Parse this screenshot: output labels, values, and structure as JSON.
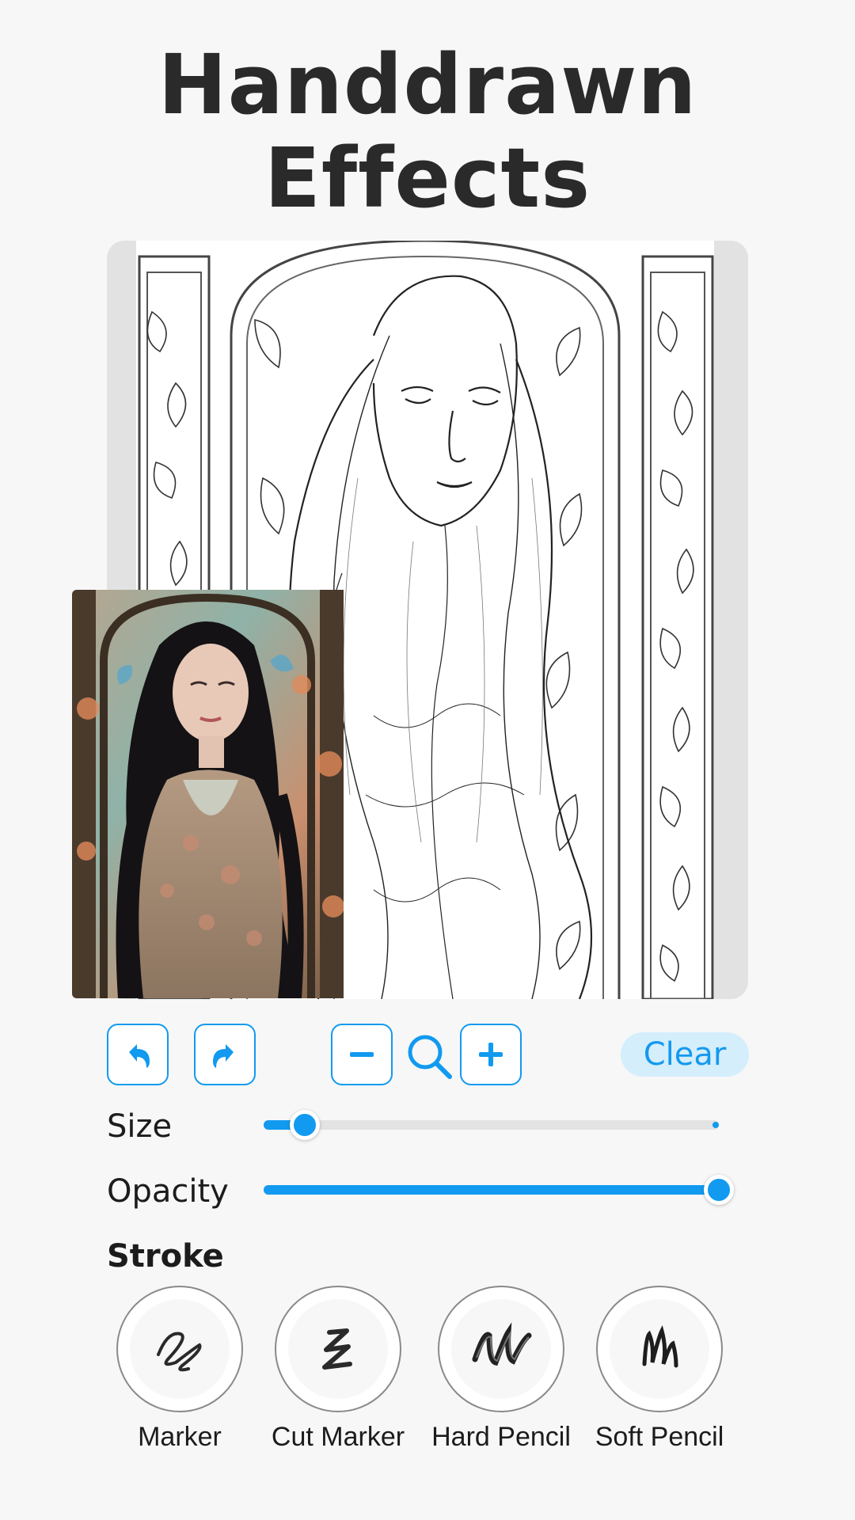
{
  "headline": {
    "line1": "Handdrawn",
    "line2": "Effects"
  },
  "toolbar": {
    "undo_icon": "undo-icon",
    "redo_icon": "redo-icon",
    "zoom_out_icon": "minus-icon",
    "zoom_icon": "magnifier-icon",
    "zoom_in_icon": "plus-icon",
    "clear_label": "Clear"
  },
  "sliders": {
    "size": {
      "label": "Size",
      "value": 0.09
    },
    "opacity": {
      "label": "Opacity",
      "value": 1.0
    }
  },
  "stroke": {
    "heading": "Stroke",
    "options": [
      {
        "label": "Marker",
        "icon": "marker-stroke-icon"
      },
      {
        "label": "Cut Marker",
        "icon": "cut-marker-stroke-icon"
      },
      {
        "label": "Hard Pencil",
        "icon": "hard-pencil-stroke-icon"
      },
      {
        "label": "Soft Pencil",
        "icon": "soft-pencil-stroke-icon"
      }
    ]
  },
  "colors": {
    "accent": "#119af0",
    "clear_bg": "#d4eefc",
    "headline": "#2a2a2a"
  }
}
